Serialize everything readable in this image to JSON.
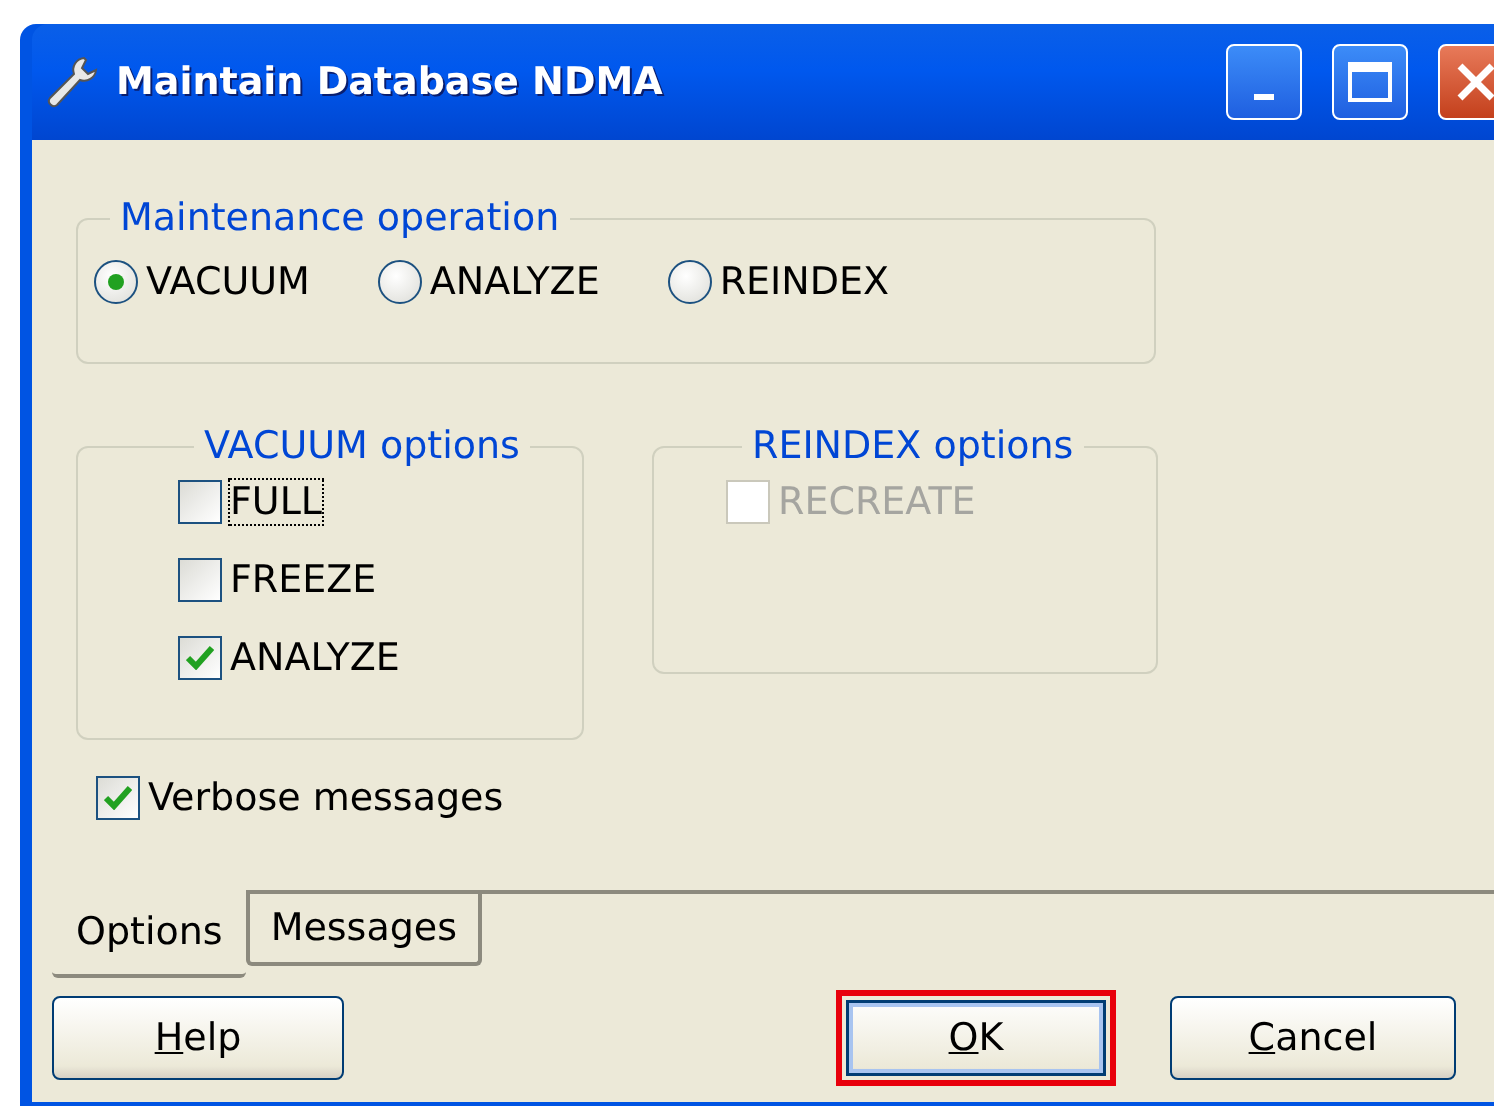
{
  "window": {
    "title": "Maintain Database NDMA",
    "controls": [
      {
        "kind": "minimize"
      },
      {
        "kind": "maximize"
      },
      {
        "kind": "close"
      }
    ]
  },
  "operation_group": {
    "title": "Maintenance operation",
    "options": [
      {
        "label": "VACUUM",
        "selected": true
      },
      {
        "label": "ANALYZE",
        "selected": false
      },
      {
        "label": "REINDEX",
        "selected": false
      }
    ]
  },
  "vacuum_options": {
    "title": "VACUUM options",
    "items": [
      {
        "label": "FULL",
        "checked": false,
        "disabled": false,
        "focused": true
      },
      {
        "label": "FREEZE",
        "checked": false,
        "disabled": false,
        "focused": false
      },
      {
        "label": "ANALYZE",
        "checked": true,
        "disabled": false,
        "focused": false
      }
    ]
  },
  "reindex_options": {
    "title": "REINDEX options",
    "items": [
      {
        "label": "RECREATE",
        "checked": false,
        "disabled": true,
        "focused": false
      }
    ]
  },
  "verbose": {
    "label": "Verbose messages",
    "checked": true,
    "disabled": false,
    "focused": false
  },
  "tabs": [
    {
      "label": "Options",
      "selected": true
    },
    {
      "label": "Messages",
      "selected": false
    }
  ],
  "buttons": [
    {
      "access_key": "H",
      "label_after_key": "elp",
      "highlighted": false
    },
    {
      "access_key": "O",
      "label_after_key": "K",
      "highlighted": true
    },
    {
      "access_key": "C",
      "label_after_key": "ancel",
      "highlighted": false
    }
  ]
}
